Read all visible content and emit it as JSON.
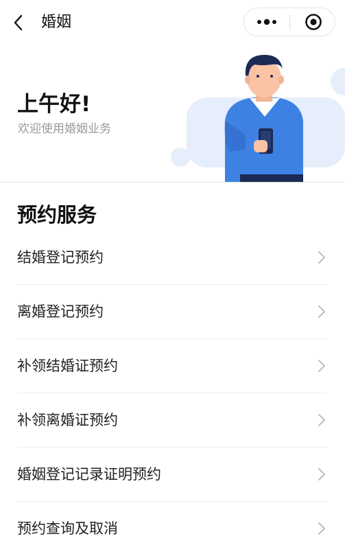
{
  "nav": {
    "title": "婚姻"
  },
  "hero": {
    "greeting": "上午好!",
    "welcome": "欢迎使用婚姻业务"
  },
  "section": {
    "title": "预约服务"
  },
  "menu": {
    "items": [
      {
        "label": "结婚登记预约"
      },
      {
        "label": "离婚登记预约"
      },
      {
        "label": "补领结婚证预约"
      },
      {
        "label": "补领离婚证预约"
      },
      {
        "label": "婚姻登记记录证明预约"
      },
      {
        "label": "预约查询及取消"
      }
    ]
  },
  "icons": {
    "back": "chevron-left-icon",
    "more": "more-dots-icon",
    "close": "target-close-icon",
    "row_arrow": "chevron-right-icon"
  },
  "colors": {
    "accent_blue": "#3d82e3",
    "navy": "#1c2a55",
    "cloud": "#e6eefb",
    "skin": "#f9c3a4",
    "muted_text": "#9a9a9a"
  }
}
